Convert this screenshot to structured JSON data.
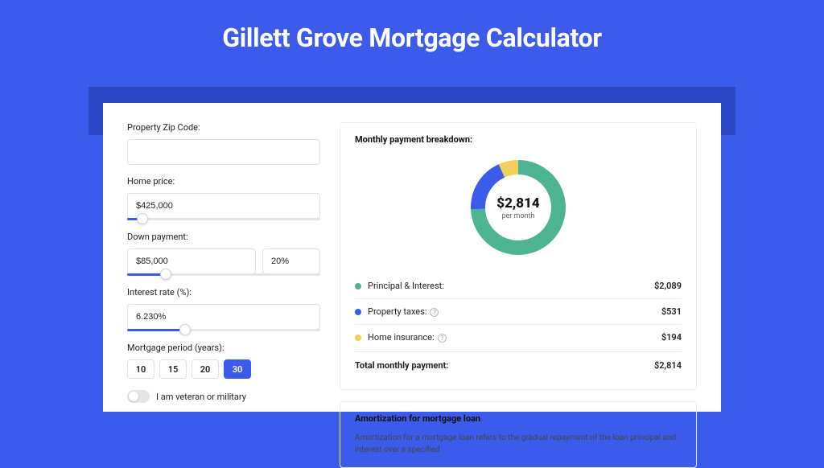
{
  "title": "Gillett Grove Mortgage Calculator",
  "form": {
    "zip_label": "Property Zip Code:",
    "zip_value": "",
    "price_label": "Home price:",
    "price_value": "$425,000",
    "price_slider_pct": 8,
    "down_label": "Down payment:",
    "down_value": "$85,000",
    "down_pct_value": "20%",
    "down_slider_pct": 20,
    "rate_label": "Interest rate (%):",
    "rate_value": "6.230%",
    "rate_slider_pct": 30,
    "period_label": "Mortgage period (years):",
    "periods": [
      "10",
      "15",
      "20",
      "30"
    ],
    "period_active": "30",
    "veteran_label": "I am veteran or military"
  },
  "breakdown": {
    "title": "Monthly payment breakdown:",
    "center_amount": "$2,814",
    "center_sub": "per month",
    "items": [
      {
        "label": "Principal & Interest:",
        "value": "$2,089",
        "color": "g",
        "info": false
      },
      {
        "label": "Property taxes:",
        "value": "$531",
        "color": "b",
        "info": true
      },
      {
        "label": "Home insurance:",
        "value": "$194",
        "color": "y",
        "info": true
      }
    ],
    "total_label": "Total monthly payment:",
    "total_value": "$2,814"
  },
  "amort": {
    "title": "Amortization for mortgage loan",
    "text": "Amortization for a mortgage loan refers to the gradual repayment of the loan principal and interest over a specified"
  },
  "chart_data": {
    "type": "pie",
    "title": "Monthly payment breakdown",
    "series": [
      {
        "name": "Principal & Interest",
        "value": 2089,
        "color": "#4cb493"
      },
      {
        "name": "Property taxes",
        "value": 531,
        "color": "#3b5beb"
      },
      {
        "name": "Home insurance",
        "value": 194,
        "color": "#f2cf5b"
      }
    ],
    "total": 2814,
    "unit": "USD per month"
  }
}
